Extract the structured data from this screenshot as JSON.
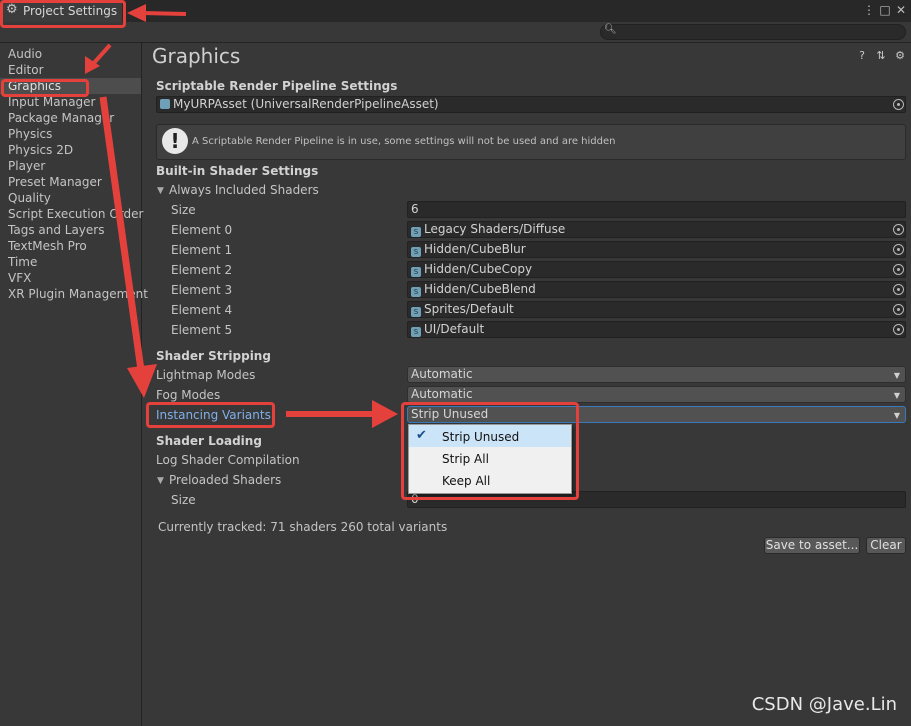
{
  "window": {
    "tab_title": "Project Settings",
    "tab_icon": "gear-icon",
    "menu_icon": "more-vertical-icon",
    "maximize_icon": "maximize-icon",
    "close_icon": "close-icon"
  },
  "search": {
    "icon": "search-icon",
    "value": ""
  },
  "sidebar": {
    "items": [
      {
        "label": "Audio"
      },
      {
        "label": "Editor"
      },
      {
        "label": "Graphics"
      },
      {
        "label": "Input Manager"
      },
      {
        "label": "Package Manager"
      },
      {
        "label": "Physics"
      },
      {
        "label": "Physics 2D"
      },
      {
        "label": "Player"
      },
      {
        "label": "Preset Manager"
      },
      {
        "label": "Quality"
      },
      {
        "label": "Script Execution Order"
      },
      {
        "label": "Tags and Layers"
      },
      {
        "label": "TextMesh Pro"
      },
      {
        "label": "Time"
      },
      {
        "label": "VFX"
      },
      {
        "label": "XR Plugin Management"
      }
    ],
    "selected_index": 2
  },
  "main": {
    "title": "Graphics",
    "header_icons": [
      "help-icon",
      "presets-icon",
      "settings-icon"
    ],
    "srp": {
      "heading": "Scriptable Render Pipeline Settings",
      "asset_value": "MyURPAsset (UniversalRenderPipelineAsset)",
      "warning_text": "A Scriptable Render Pipeline is in use, some settings will not be used and are hidden"
    },
    "builtin": {
      "heading": "Built-in Shader Settings",
      "foldout_label": "Always Included Shaders",
      "size_label": "Size",
      "size_value": "6",
      "elements": [
        {
          "label": "Element 0",
          "value": "Legacy Shaders/Diffuse"
        },
        {
          "label": "Element 1",
          "value": "Hidden/CubeBlur"
        },
        {
          "label": "Element 2",
          "value": "Hidden/CubeCopy"
        },
        {
          "label": "Element 3",
          "value": "Hidden/CubeBlend"
        },
        {
          "label": "Element 4",
          "value": "Sprites/Default"
        },
        {
          "label": "Element 5",
          "value": "UI/Default"
        }
      ]
    },
    "stripping": {
      "heading": "Shader Stripping",
      "lightmap_label": "Lightmap Modes",
      "lightmap_value": "Automatic",
      "fog_label": "Fog Modes",
      "fog_value": "Automatic",
      "instancing_label": "Instancing Variants",
      "instancing_value": "Strip Unused"
    },
    "loading": {
      "heading": "Shader Loading",
      "log_label": "Log Shader Compilation",
      "preloaded_label": "Preloaded Shaders",
      "size_label": "Size",
      "size_value": "0"
    },
    "tracked_text": "Currently tracked: 71 shaders 260 total variants",
    "save_button": "Save to asset...",
    "clear_button": "Clear"
  },
  "popup": {
    "options": [
      "Strip Unused",
      "Strip All",
      "Keep All"
    ],
    "selected_index": 0
  },
  "annotation_color": "#e5413c",
  "watermark": "CSDN @Jave.Lin"
}
